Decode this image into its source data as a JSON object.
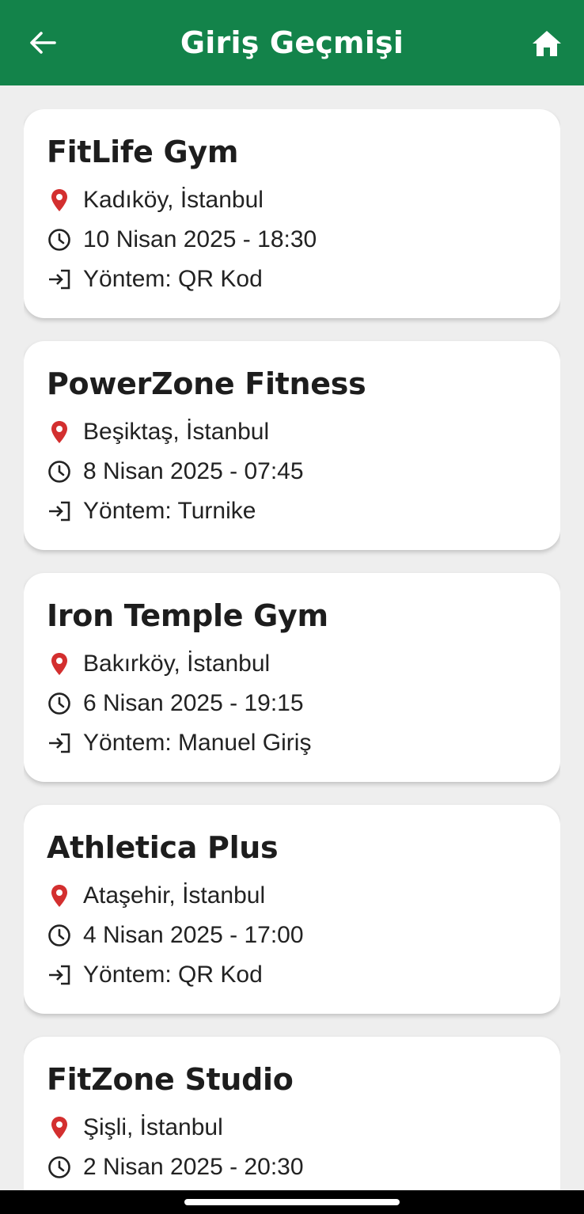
{
  "header": {
    "title": "Giriş Geçmişi",
    "back_icon": "arrow-left-icon",
    "home_icon": "home-icon",
    "background": "#13834a"
  },
  "entries": [
    {
      "name": "FitLife Gym",
      "location": "Kadıköy, İstanbul",
      "datetime": "10 Nisan 2025 - 18:30",
      "method": "Yöntem: QR Kod"
    },
    {
      "name": "PowerZone Fitness",
      "location": "Beşiktaş, İstanbul",
      "datetime": "8 Nisan 2025 - 07:45",
      "method": "Yöntem: Turnike"
    },
    {
      "name": "Iron Temple Gym",
      "location": "Bakırköy, İstanbul",
      "datetime": "6 Nisan 2025 - 19:15",
      "method": "Yöntem: Manuel Giriş"
    },
    {
      "name": "Athletica Plus",
      "location": "Ataşehir, İstanbul",
      "datetime": "4 Nisan 2025 - 17:00",
      "method": "Yöntem: QR Kod"
    },
    {
      "name": "FitZone Studio",
      "location": "Şişli, İstanbul",
      "datetime": "2 Nisan 2025 - 20:30",
      "method": ""
    }
  ],
  "icons": {
    "location": "location-pin-icon",
    "time": "clock-icon",
    "method": "login-icon",
    "pin_color": "#d32f2f"
  }
}
